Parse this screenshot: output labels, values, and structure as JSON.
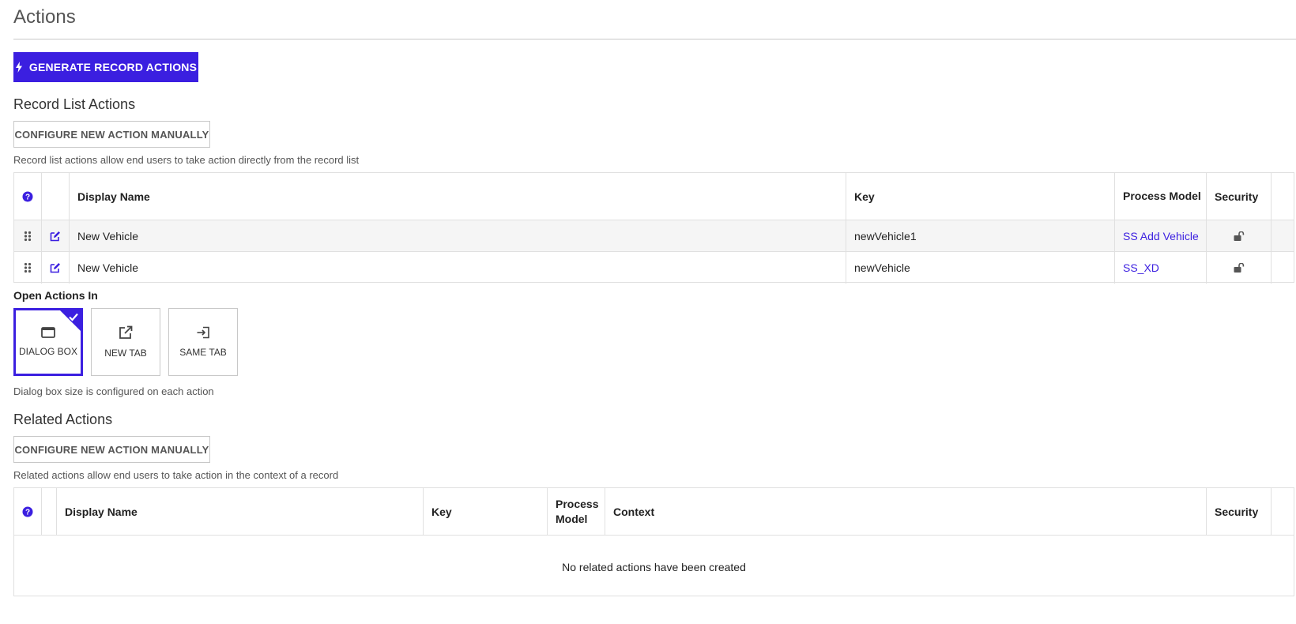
{
  "page": {
    "title": "Actions"
  },
  "generate_button": {
    "label": "GENERATE RECORD ACTIONS"
  },
  "record_list": {
    "title": "Record List Actions",
    "configure_label": "CONFIGURE NEW ACTION MANUALLY",
    "hint": "Record list actions allow end users to take action directly from the record list",
    "columns": {
      "display_name": "Display Name",
      "key": "Key",
      "process_model": "Process Model",
      "security": "Security"
    },
    "rows": [
      {
        "display_name": "New Vehicle",
        "key": "newVehicle1",
        "process_model": "SS Add Vehicle"
      },
      {
        "display_name": "New Vehicle",
        "key": "newVehicle",
        "process_model": "SS_XD"
      }
    ]
  },
  "open_actions": {
    "label": "Open Actions In",
    "options": [
      {
        "label": "DIALOG BOX",
        "selected": true
      },
      {
        "label": "NEW TAB",
        "selected": false
      },
      {
        "label": "SAME TAB",
        "selected": false
      }
    ],
    "hint": "Dialog box size is configured on each action"
  },
  "related": {
    "title": "Related Actions",
    "configure_label": "CONFIGURE NEW ACTION MANUALLY",
    "hint": "Related actions allow end users to take action in the context of a record",
    "columns": {
      "display_name": "Display Name",
      "key": "Key",
      "process_model": "Process Model",
      "context": "Context",
      "security": "Security"
    },
    "empty": "No related actions have been created"
  },
  "colors": {
    "accent": "#3b1fe0",
    "border": "#e0e0e0"
  }
}
